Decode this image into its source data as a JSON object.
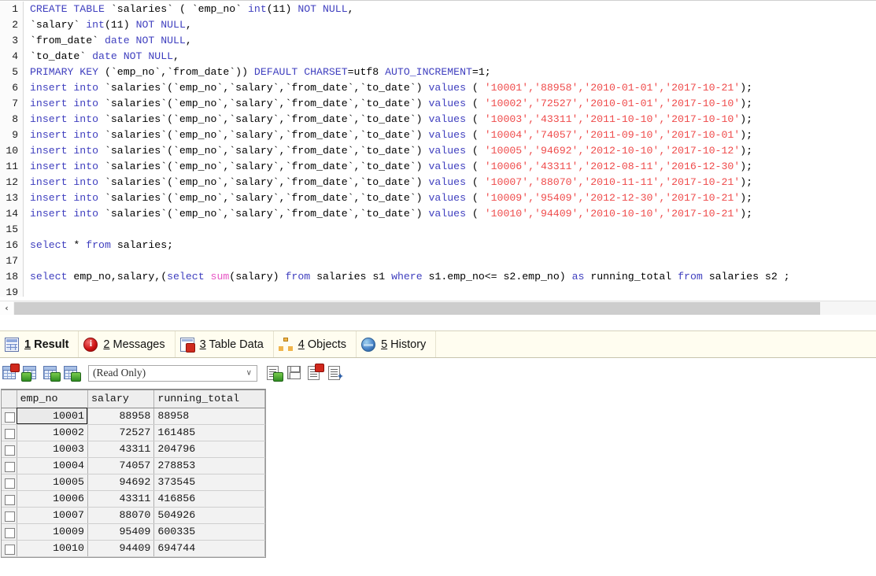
{
  "editor": {
    "lines": [
      {
        "n": "1",
        "tokens": [
          {
            "t": "CREATE TABLE ",
            "c": "kw"
          },
          {
            "t": "`salaries` ( `emp_no` ",
            "c": "plain"
          },
          {
            "t": "int",
            "c": "kw"
          },
          {
            "t": "(11) ",
            "c": "plain"
          },
          {
            "t": "NOT NULL",
            "c": "kw"
          },
          {
            "t": ",",
            "c": "plain"
          }
        ]
      },
      {
        "n": "2",
        "tokens": [
          {
            "t": "`salary` ",
            "c": "plain"
          },
          {
            "t": "int",
            "c": "kw"
          },
          {
            "t": "(11) ",
            "c": "plain"
          },
          {
            "t": "NOT NULL",
            "c": "kw"
          },
          {
            "t": ",",
            "c": "plain"
          }
        ]
      },
      {
        "n": "3",
        "tokens": [
          {
            "t": "`from_date` ",
            "c": "plain"
          },
          {
            "t": "date NOT NULL",
            "c": "kw"
          },
          {
            "t": ",",
            "c": "plain"
          }
        ]
      },
      {
        "n": "4",
        "tokens": [
          {
            "t": "`to_date` ",
            "c": "plain"
          },
          {
            "t": "date NOT NULL",
            "c": "kw"
          },
          {
            "t": ",",
            "c": "plain"
          }
        ]
      },
      {
        "n": "5",
        "tokens": [
          {
            "t": "PRIMARY KEY ",
            "c": "kw"
          },
          {
            "t": "(`emp_no`,`from_date`)) ",
            "c": "plain"
          },
          {
            "t": "DEFAULT CHARSET",
            "c": "kw"
          },
          {
            "t": "=utf8 ",
            "c": "plain"
          },
          {
            "t": "AUTO_INCREMENT",
            "c": "kw"
          },
          {
            "t": "=1;",
            "c": "plain"
          }
        ]
      },
      {
        "n": "6",
        "tokens": [
          {
            "t": "insert into ",
            "c": "kw"
          },
          {
            "t": "`salaries`(`emp_no`,`salary`,`from_date`,`to_date`) ",
            "c": "plain"
          },
          {
            "t": "values",
            "c": "kw"
          },
          {
            "t": " ( ",
            "c": "plain"
          },
          {
            "t": "'10001','88958','2010-01-01','2017-10-21'",
            "c": "str"
          },
          {
            "t": ");",
            "c": "plain"
          }
        ]
      },
      {
        "n": "7",
        "tokens": [
          {
            "t": "insert into ",
            "c": "kw"
          },
          {
            "t": "`salaries`(`emp_no`,`salary`,`from_date`,`to_date`) ",
            "c": "plain"
          },
          {
            "t": "values",
            "c": "kw"
          },
          {
            "t": " ( ",
            "c": "plain"
          },
          {
            "t": "'10002','72527','2010-01-01','2017-10-10'",
            "c": "str"
          },
          {
            "t": ");",
            "c": "plain"
          }
        ]
      },
      {
        "n": "8",
        "tokens": [
          {
            "t": "insert into ",
            "c": "kw"
          },
          {
            "t": "`salaries`(`emp_no`,`salary`,`from_date`,`to_date`) ",
            "c": "plain"
          },
          {
            "t": "values",
            "c": "kw"
          },
          {
            "t": " ( ",
            "c": "plain"
          },
          {
            "t": "'10003','43311','2011-10-10','2017-10-10'",
            "c": "str"
          },
          {
            "t": ");",
            "c": "plain"
          }
        ]
      },
      {
        "n": "9",
        "tokens": [
          {
            "t": "insert into ",
            "c": "kw"
          },
          {
            "t": "`salaries`(`emp_no`,`salary`,`from_date`,`to_date`) ",
            "c": "plain"
          },
          {
            "t": "values",
            "c": "kw"
          },
          {
            "t": " ( ",
            "c": "plain"
          },
          {
            "t": "'10004','74057','2011-09-10','2017-10-01'",
            "c": "str"
          },
          {
            "t": ");",
            "c": "plain"
          }
        ]
      },
      {
        "n": "10",
        "tokens": [
          {
            "t": "insert into ",
            "c": "kw"
          },
          {
            "t": "`salaries`(`emp_no`,`salary`,`from_date`,`to_date`) ",
            "c": "plain"
          },
          {
            "t": "values",
            "c": "kw"
          },
          {
            "t": " ( ",
            "c": "plain"
          },
          {
            "t": "'10005','94692','2012-10-10','2017-10-12'",
            "c": "str"
          },
          {
            "t": ");",
            "c": "plain"
          }
        ]
      },
      {
        "n": "11",
        "tokens": [
          {
            "t": "insert into ",
            "c": "kw"
          },
          {
            "t": "`salaries`(`emp_no`,`salary`,`from_date`,`to_date`) ",
            "c": "plain"
          },
          {
            "t": "values",
            "c": "kw"
          },
          {
            "t": " ( ",
            "c": "plain"
          },
          {
            "t": "'10006','43311','2012-08-11','2016-12-30'",
            "c": "str"
          },
          {
            "t": ");",
            "c": "plain"
          }
        ]
      },
      {
        "n": "12",
        "tokens": [
          {
            "t": "insert into ",
            "c": "kw"
          },
          {
            "t": "`salaries`(`emp_no`,`salary`,`from_date`,`to_date`) ",
            "c": "plain"
          },
          {
            "t": "values",
            "c": "kw"
          },
          {
            "t": " ( ",
            "c": "plain"
          },
          {
            "t": "'10007','88070','2010-11-11','2017-10-21'",
            "c": "str"
          },
          {
            "t": ");",
            "c": "plain"
          }
        ]
      },
      {
        "n": "13",
        "tokens": [
          {
            "t": "insert into ",
            "c": "kw"
          },
          {
            "t": "`salaries`(`emp_no`,`salary`,`from_date`,`to_date`) ",
            "c": "plain"
          },
          {
            "t": "values",
            "c": "kw"
          },
          {
            "t": " ( ",
            "c": "plain"
          },
          {
            "t": "'10009','95409','2012-12-30','2017-10-21'",
            "c": "str"
          },
          {
            "t": ");",
            "c": "plain"
          }
        ]
      },
      {
        "n": "14",
        "tokens": [
          {
            "t": "insert into ",
            "c": "kw"
          },
          {
            "t": "`salaries`(`emp_no`,`salary`,`from_date`,`to_date`) ",
            "c": "plain"
          },
          {
            "t": "values",
            "c": "kw"
          },
          {
            "t": " ( ",
            "c": "plain"
          },
          {
            "t": "'10010','94409','2010-10-10','2017-10-21'",
            "c": "str"
          },
          {
            "t": ");",
            "c": "plain"
          }
        ]
      },
      {
        "n": "15",
        "tokens": []
      },
      {
        "n": "16",
        "tokens": [
          {
            "t": "select ",
            "c": "kw"
          },
          {
            "t": "* ",
            "c": "plain"
          },
          {
            "t": "from ",
            "c": "kw"
          },
          {
            "t": "salaries;",
            "c": "plain"
          }
        ]
      },
      {
        "n": "17",
        "tokens": []
      },
      {
        "n": "18",
        "tokens": [
          {
            "t": "select ",
            "c": "kw"
          },
          {
            "t": "emp_no,salary,(",
            "c": "plain"
          },
          {
            "t": "select ",
            "c": "kw"
          },
          {
            "t": "sum",
            "c": "fn"
          },
          {
            "t": "(salary) ",
            "c": "plain"
          },
          {
            "t": "from ",
            "c": "kw"
          },
          {
            "t": "salaries s1 ",
            "c": "plain"
          },
          {
            "t": "where ",
            "c": "kw"
          },
          {
            "t": "s1.emp_no<= s2.emp_no) ",
            "c": "plain"
          },
          {
            "t": "as ",
            "c": "kw"
          },
          {
            "t": "running_total ",
            "c": "plain"
          },
          {
            "t": "from ",
            "c": "kw"
          },
          {
            "t": "salaries s2 ;",
            "c": "plain"
          }
        ]
      },
      {
        "n": "19",
        "tokens": []
      }
    ]
  },
  "scrollbar": {
    "left_arrow": "‹"
  },
  "tabs": [
    {
      "num": "1",
      "label": "Result",
      "icon": "result-grid-icon",
      "active": true
    },
    {
      "num": "2",
      "label": "Messages",
      "icon": "error-info-icon",
      "active": false
    },
    {
      "num": "3",
      "label": "Table Data",
      "icon": "table-data-icon",
      "active": false
    },
    {
      "num": "4",
      "label": "Objects",
      "icon": "objects-tree-icon",
      "active": false
    },
    {
      "num": "5",
      "label": "History",
      "icon": "history-globe-icon",
      "active": false
    }
  ],
  "result_toolbar": {
    "mode_value": "(Read Only)",
    "caret": "∨",
    "buttons": [
      {
        "name": "grid-view-button"
      },
      {
        "name": "insert-row-button"
      },
      {
        "name": "update-row-button"
      },
      {
        "name": "duplicate-row-button"
      },
      {
        "name": "export-button"
      },
      {
        "name": "save-button"
      },
      {
        "name": "delete-row-button"
      },
      {
        "name": "refresh-button"
      }
    ]
  },
  "result_grid": {
    "columns": [
      "emp_no",
      "salary",
      "running_total"
    ],
    "rows": [
      [
        "10001",
        "88958",
        "88958"
      ],
      [
        "10002",
        "72527",
        "161485"
      ],
      [
        "10003",
        "43311",
        "204796"
      ],
      [
        "10004",
        "74057",
        "278853"
      ],
      [
        "10005",
        "94692",
        "373545"
      ],
      [
        "10006",
        "43311",
        "416856"
      ],
      [
        "10007",
        "88070",
        "504926"
      ],
      [
        "10009",
        "95409",
        "600335"
      ],
      [
        "10010",
        "94409",
        "694744"
      ]
    ]
  },
  "colors": {
    "keyword": "#3f3fbf",
    "string": "#ef4b4b",
    "function": "#e754c4",
    "pk_header": "#fdbe69",
    "tabstrip_bg": "#fffdf0"
  }
}
